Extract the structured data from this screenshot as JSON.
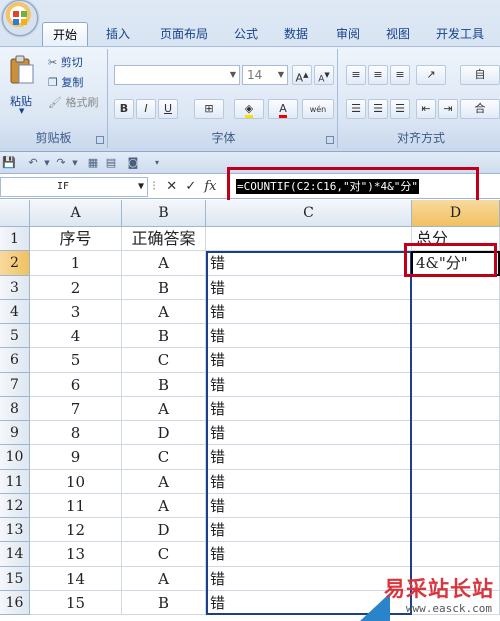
{
  "tabs": [
    "开始",
    "插入",
    "页面布局",
    "公式",
    "数据",
    "审阅",
    "视图",
    "开发工具"
  ],
  "ribbon": {
    "clipboard": {
      "paste": "粘贴",
      "cut": "剪切",
      "copy": "复制",
      "format_painter": "格式刷",
      "title": "剪贴板"
    },
    "font": {
      "size": "14",
      "title": "字体",
      "bold": "B",
      "italic": "I",
      "underline": "U",
      "grow": "A",
      "shrink": "A",
      "wen": "wén"
    },
    "alignment": {
      "title": "对齐方式",
      "wrap": "自",
      "merge": "合"
    }
  },
  "formula_bar": {
    "name_box": "IF",
    "fx": "fx",
    "formula": "=COUNTIF(C2:C16,\"对\")*4&\"分\""
  },
  "columns": [
    "A",
    "B",
    "C",
    "D"
  ],
  "rows": [
    {
      "n": "1",
      "a": "序号",
      "b": "正确答案",
      "c": "",
      "d": "总分"
    },
    {
      "n": "2",
      "a": "1",
      "b": "A",
      "c": "错",
      "d": "4&\"分\""
    },
    {
      "n": "3",
      "a": "2",
      "b": "B",
      "c": "错",
      "d": ""
    },
    {
      "n": "4",
      "a": "3",
      "b": "A",
      "c": "错",
      "d": ""
    },
    {
      "n": "5",
      "a": "4",
      "b": "B",
      "c": "错",
      "d": ""
    },
    {
      "n": "6",
      "a": "5",
      "b": "C",
      "c": "错",
      "d": ""
    },
    {
      "n": "7",
      "a": "6",
      "b": "B",
      "c": "错",
      "d": ""
    },
    {
      "n": "8",
      "a": "7",
      "b": "A",
      "c": "错",
      "d": ""
    },
    {
      "n": "9",
      "a": "8",
      "b": "D",
      "c": "错",
      "d": ""
    },
    {
      "n": "10",
      "a": "9",
      "b": "C",
      "c": "错",
      "d": ""
    },
    {
      "n": "11",
      "a": "10",
      "b": "A",
      "c": "错",
      "d": ""
    },
    {
      "n": "12",
      "a": "11",
      "b": "A",
      "c": "错",
      "d": ""
    },
    {
      "n": "13",
      "a": "12",
      "b": "D",
      "c": "错",
      "d": ""
    },
    {
      "n": "14",
      "a": "13",
      "b": "C",
      "c": "错",
      "d": ""
    },
    {
      "n": "15",
      "a": "14",
      "b": "A",
      "c": "错",
      "d": ""
    },
    {
      "n": "16",
      "a": "15",
      "b": "B",
      "c": "错",
      "d": ""
    }
  ],
  "watermark": {
    "title": "易采站长站",
    "url": "www.easck.com"
  },
  "colors": {
    "highlight_box": "#c00018",
    "selection": "#1d3f86"
  }
}
